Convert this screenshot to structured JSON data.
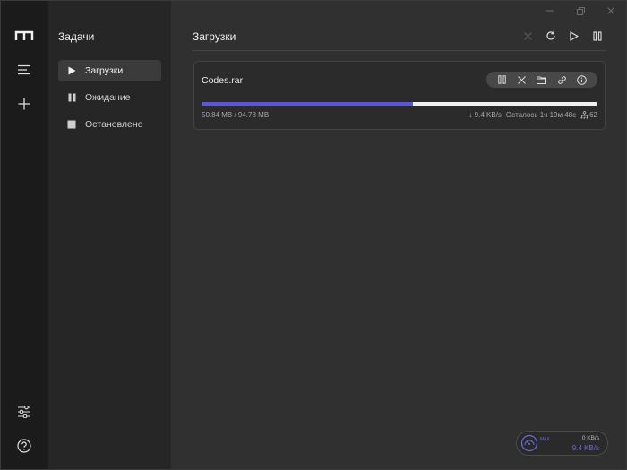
{
  "sidebar_title": "Задачи",
  "task_items": [
    {
      "label": "Загрузки",
      "icon": "play-icon"
    },
    {
      "label": "Ожидание",
      "icon": "pause-icon"
    },
    {
      "label": "Остановлено",
      "icon": "stop-icon"
    }
  ],
  "main_title": "Загрузки",
  "download": {
    "file_name": "Codes.rar",
    "progress_percent": 53.4,
    "sizes": "50.84 MB / 94.78 MB",
    "speed": "↓ 9.4 KB/s",
    "remaining": "Осталось 1ч 19м 48с",
    "connections": "62"
  },
  "speed_widget": {
    "max_label": "MAX",
    "upload": "0 KB/s",
    "download": "9.4 KB/s"
  },
  "colors": {
    "accent": "#5b57d6",
    "rail_bg": "#1b1b1b",
    "sidebar_bg": "#262626",
    "main_bg": "#303030"
  }
}
